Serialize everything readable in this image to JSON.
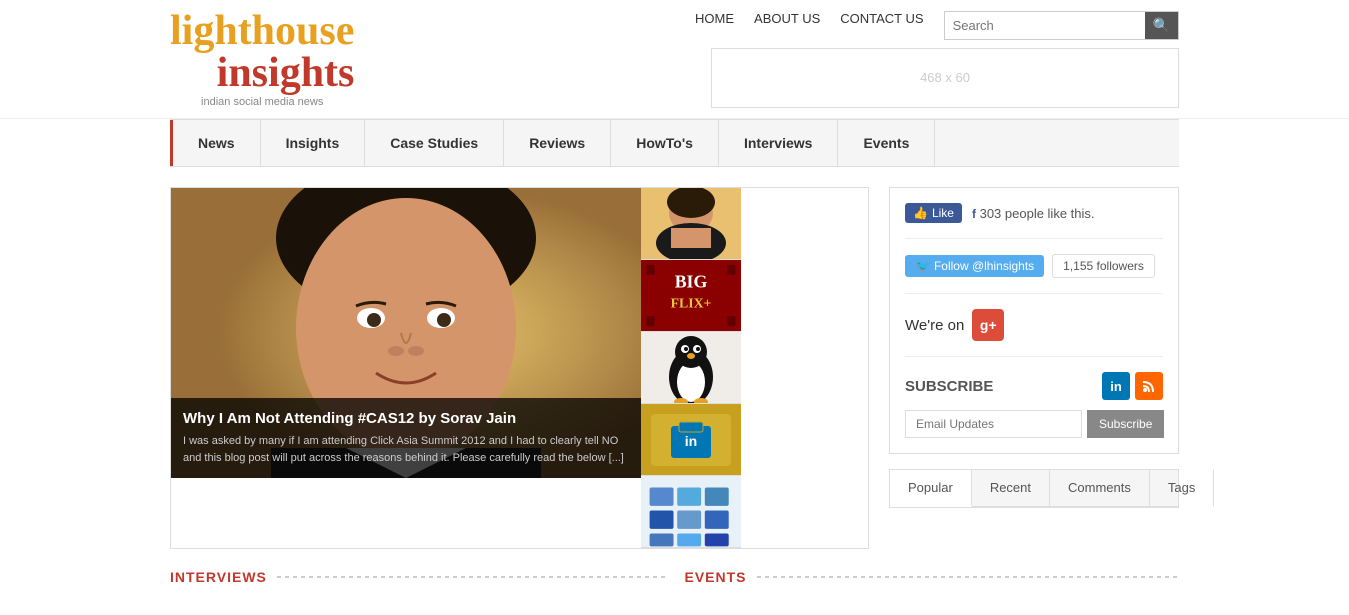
{
  "site": {
    "logo_part1": "lighthouse",
    "logo_part2": "insights",
    "tagline": "indian social media news"
  },
  "header": {
    "nav": {
      "home": "HOME",
      "about": "ABOUT US",
      "contact": "CONTACT US"
    },
    "search": {
      "placeholder": "Search",
      "button_icon": "🔍"
    },
    "ad_text": "468 x 60"
  },
  "navbar": {
    "items": [
      {
        "label": "News"
      },
      {
        "label": "Insights"
      },
      {
        "label": "Case Studies"
      },
      {
        "label": "Reviews"
      },
      {
        "label": "HowTo's"
      },
      {
        "label": "Interviews"
      },
      {
        "label": "Events"
      }
    ]
  },
  "featured": {
    "title": "Why I Am Not Attending #CAS12 by Sorav Jain",
    "excerpt": "I was asked by many if I am attending Click Asia Summit 2012 and I had to clearly tell NO and this blog post will put across the reasons behind it. Please carefully read the below [...]"
  },
  "sidebar": {
    "facebook": {
      "like_label": "Like",
      "count_text": "303 people like this."
    },
    "twitter": {
      "follow_label": "Follow @lhinsights",
      "followers_text": "1,155 followers"
    },
    "gplus": {
      "text": "We're on",
      "icon_label": "g+"
    },
    "subscribe": {
      "title": "SUBSCRIBE",
      "li_label": "in",
      "rss_label": "◌",
      "email_placeholder": "Email Updates",
      "button_label": "Subscribe"
    }
  },
  "bottom": {
    "interviews_label": "INTERVIEWS",
    "events_label": "EVENTS"
  },
  "content_tabs": {
    "tabs": [
      {
        "label": "Popular"
      },
      {
        "label": "Recent"
      },
      {
        "label": "Comments"
      },
      {
        "label": "Tags"
      }
    ]
  }
}
